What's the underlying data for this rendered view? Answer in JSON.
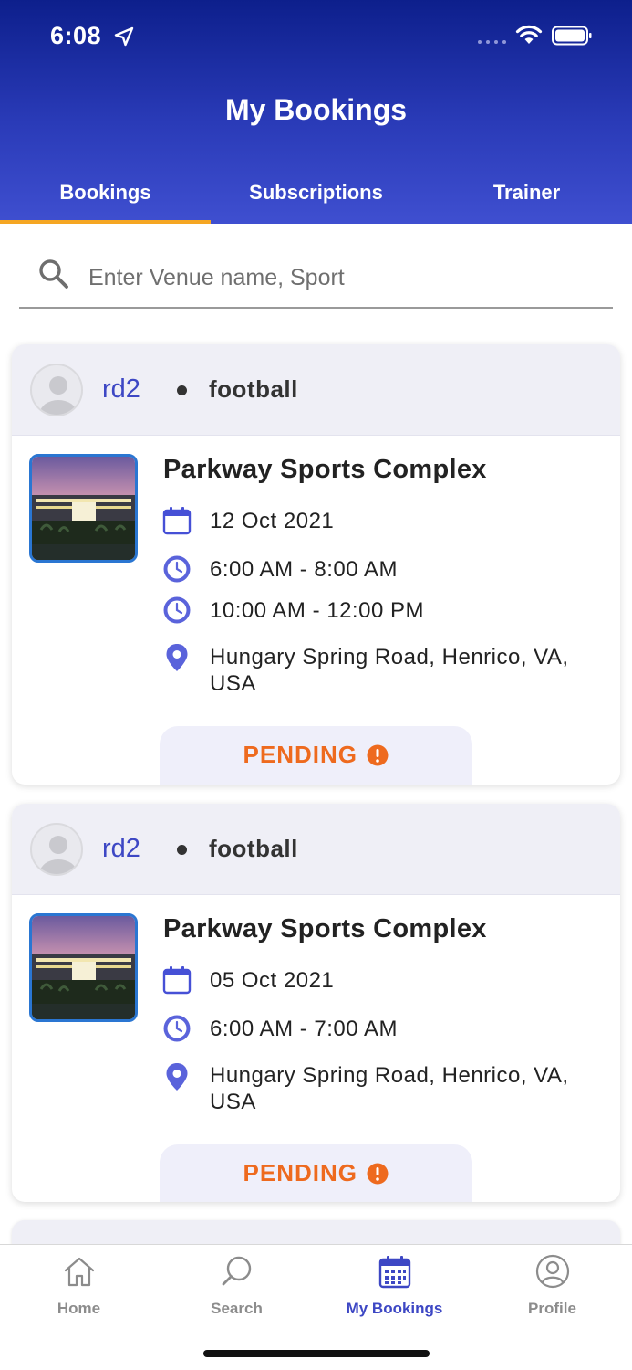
{
  "status_bar": {
    "time": "6:08"
  },
  "header": {
    "title": "My Bookings",
    "tabs": [
      {
        "label": "Bookings",
        "active": true
      },
      {
        "label": "Subscriptions",
        "active": false
      },
      {
        "label": "Trainer",
        "active": false
      }
    ]
  },
  "search": {
    "placeholder": "Enter Venue name, Sport",
    "value": ""
  },
  "bookings": [
    {
      "user": "rd2",
      "sport": "football",
      "venue": "Parkway Sports Complex",
      "date": "12 Oct 2021",
      "times": [
        "6:00 AM - 8:00 AM",
        "10:00 AM - 12:00 PM"
      ],
      "address": "Hungary Spring Road, Henrico, VA, USA",
      "status": "PENDING"
    },
    {
      "user": "rd2",
      "sport": "football",
      "venue": "Parkway Sports Complex",
      "date": "05 Oct 2021",
      "times": [
        "6:00 AM - 7:00 AM"
      ],
      "address": "Hungary Spring Road, Henrico, VA, USA",
      "status": "PENDING"
    }
  ],
  "bottom_nav": [
    {
      "label": "Home",
      "icon": "home-icon",
      "active": false
    },
    {
      "label": "Search",
      "icon": "search-icon",
      "active": false
    },
    {
      "label": "My Bookings",
      "icon": "calendar-icon",
      "active": true
    },
    {
      "label": "Profile",
      "icon": "profile-icon",
      "active": false
    }
  ],
  "colors": {
    "header_top": "#0d1f8c",
    "header_bottom": "#3f4fd0",
    "accent": "#3d47c4",
    "tab_indicator": "#f5a623",
    "pending": "#ee6a1e"
  }
}
